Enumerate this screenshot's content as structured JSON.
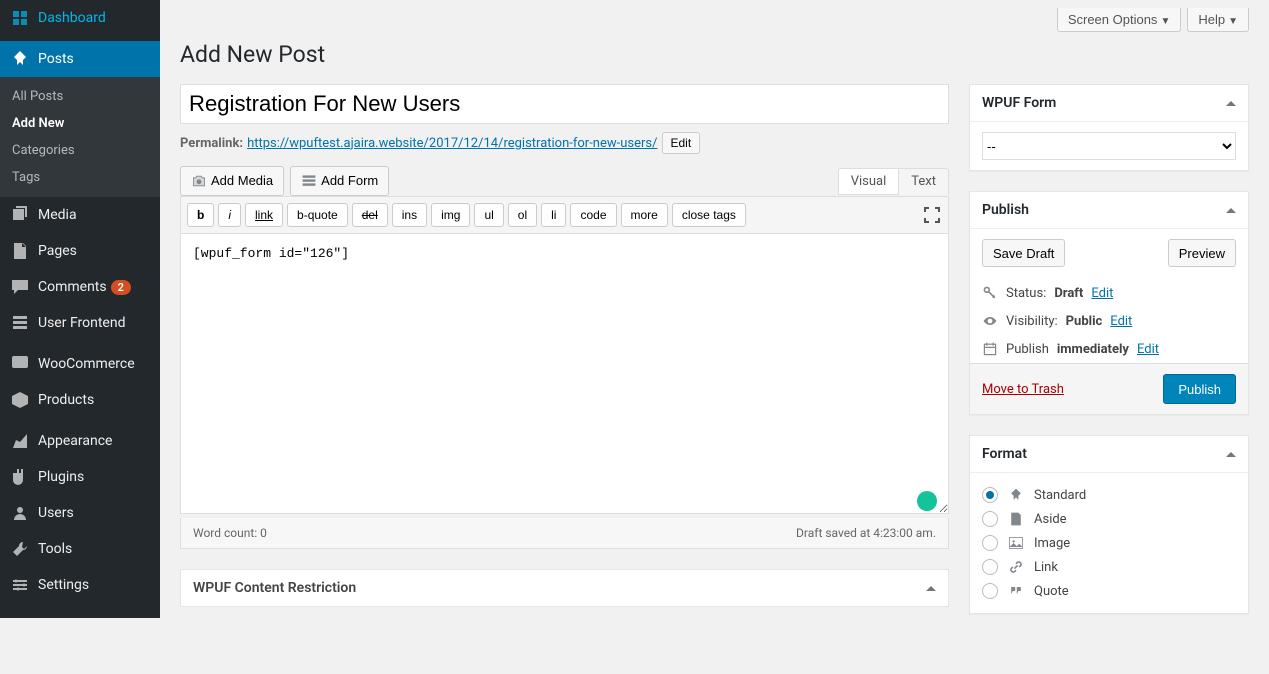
{
  "top": {
    "screen_options": "Screen Options",
    "help": "Help"
  },
  "page": {
    "title": "Add New Post"
  },
  "sidebar": {
    "items": [
      {
        "label": "Dashboard",
        "icon": "dashboard"
      },
      {
        "label": "Posts",
        "icon": "pin"
      },
      {
        "label": "Media",
        "icon": "media"
      },
      {
        "label": "Pages",
        "icon": "pages"
      },
      {
        "label": "Comments",
        "icon": "comment",
        "badge": "2"
      },
      {
        "label": "User Frontend",
        "icon": "userf"
      },
      {
        "label": "WooCommerce",
        "icon": "woo"
      },
      {
        "label": "Products",
        "icon": "products"
      },
      {
        "label": "Appearance",
        "icon": "appearance"
      },
      {
        "label": "Plugins",
        "icon": "plugins"
      },
      {
        "label": "Users",
        "icon": "users"
      },
      {
        "label": "Tools",
        "icon": "tools"
      },
      {
        "label": "Settings",
        "icon": "settings"
      }
    ],
    "submenu": [
      "All Posts",
      "Add New",
      "Categories",
      "Tags"
    ]
  },
  "post": {
    "title": "Registration For New Users",
    "permalink_label": "Permalink:",
    "permalink": "https://wpuftest.ajaira.website/2017/12/14/registration-for-new-users/",
    "permalink_edit": "Edit",
    "content": "[wpuf_form id=\"126\"]",
    "word_count_label": "Word count: 0",
    "draft_saved": "Draft saved at 4:23:00 am."
  },
  "editor": {
    "add_media": "Add Media",
    "add_form": "Add Form",
    "tab_visual": "Visual",
    "tab_text": "Text",
    "buttons": {
      "b": "b",
      "i": "i",
      "link": "link",
      "bquote": "b-quote",
      "del": "del",
      "ins": "ins",
      "img": "img",
      "ul": "ul",
      "ol": "ol",
      "li": "li",
      "code": "code",
      "more": "more",
      "close": "close tags"
    }
  },
  "metaboxes": {
    "wpuf_form": {
      "title": "WPUF Form",
      "selected": "--"
    },
    "publish": {
      "title": "Publish",
      "save_draft": "Save Draft",
      "preview": "Preview",
      "status_label": "Status:",
      "status_value": "Draft",
      "visibility_label": "Visibility:",
      "visibility_value": "Public",
      "publish_label": "Publish",
      "publish_value": "immediately",
      "edit": "Edit",
      "trash": "Move to Trash",
      "publish_btn": "Publish"
    },
    "format": {
      "title": "Format",
      "items": [
        "Standard",
        "Aside",
        "Image",
        "Link",
        "Quote"
      ]
    },
    "restriction": {
      "title": "WPUF Content Restriction"
    }
  }
}
